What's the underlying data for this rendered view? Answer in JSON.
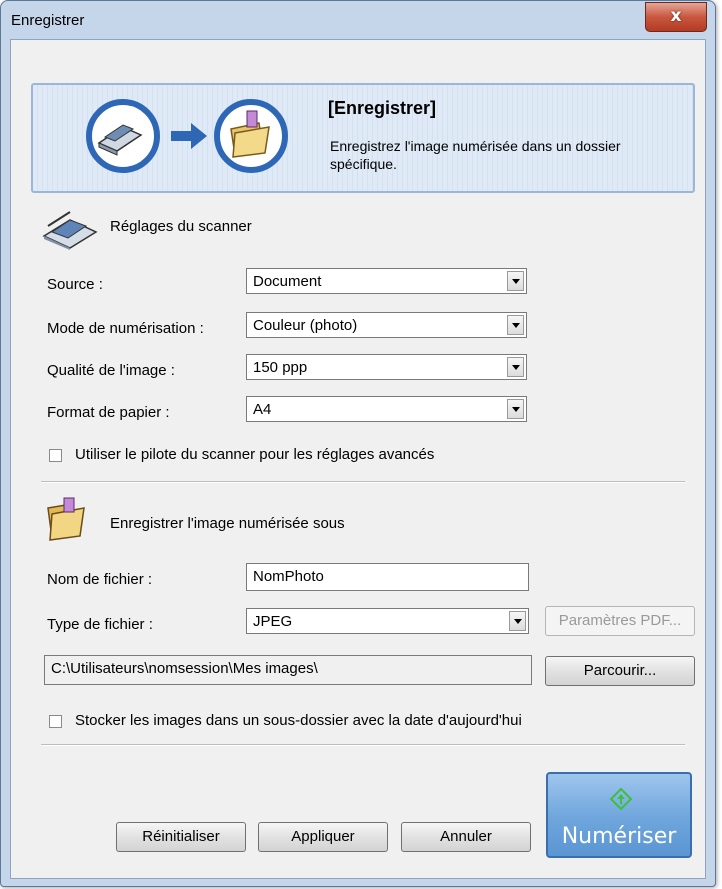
{
  "window": {
    "title": "Enregistrer",
    "close_glyph": "x"
  },
  "banner": {
    "title": "[Enregistrer]",
    "description": "Enregistrez l'image numérisée dans un dossier spécifique.",
    "icons": [
      "scanner-circle-icon",
      "arrow-right-icon",
      "folder-circle-icon"
    ]
  },
  "scanner_settings": {
    "heading": "Réglages du scanner",
    "icon": "scanner-icon",
    "source": {
      "label": "Source :",
      "value": "Document"
    },
    "mode": {
      "label": "Mode de numérisation :",
      "value": "Couleur (photo)"
    },
    "quality": {
      "label": "Qualité de l'image :",
      "value": "150 ppp"
    },
    "paper": {
      "label": "Format de papier :",
      "value": "A4"
    },
    "advanced_checkbox": {
      "label": "Utiliser le pilote du scanner pour les réglages avancés",
      "checked": false
    }
  },
  "save_settings": {
    "heading": "Enregistrer l'image numérisée sous",
    "icon": "folder-icon",
    "filename": {
      "label": "Nom de fichier :",
      "value": "NomPhoto"
    },
    "filetype": {
      "label": "Type de fichier :",
      "value": "JPEG"
    },
    "pdf_params_label": "Paramètres PDF...",
    "path": "C:\\Utilisateurs\\nomsession\\Mes images\\",
    "browse_label": "Parcourir...",
    "subfolder_checkbox": {
      "label": "Stocker les images dans un sous-dossier avec la date d'aujourd'hui",
      "checked": false
    }
  },
  "actions": {
    "reset_label": "Réinitialiser",
    "apply_label": "Appliquer",
    "cancel_label": "Annuler",
    "scan_label": "Numériser"
  },
  "colors": {
    "accent": "#6ea5dc",
    "title_close": "#c9573f",
    "scan_icon": "#3cbf3c"
  }
}
